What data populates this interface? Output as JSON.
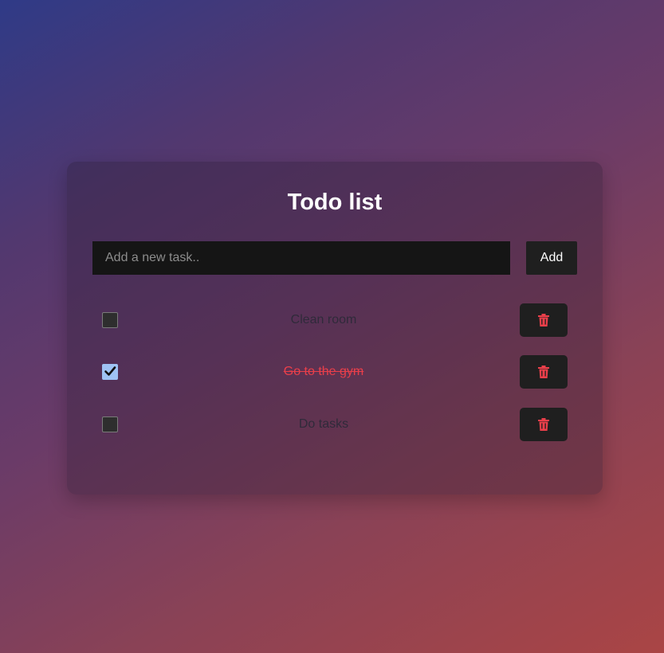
{
  "app": {
    "title": "Todo list"
  },
  "input": {
    "placeholder": "Add a new task..",
    "value": ""
  },
  "add_button": {
    "label": "Add"
  },
  "colors": {
    "delete_icon": "#ea3f4a",
    "done_text": "#ea3f4a",
    "checkbox_checked": "#9fc3f4"
  },
  "todos": [
    {
      "text": "Clean room",
      "completed": false,
      "delete_icon": "trash-icon"
    },
    {
      "text": "Go to the gym",
      "completed": true,
      "delete_icon": "trash-icon"
    },
    {
      "text": "Do tasks",
      "completed": false,
      "delete_icon": "trash-icon"
    }
  ]
}
